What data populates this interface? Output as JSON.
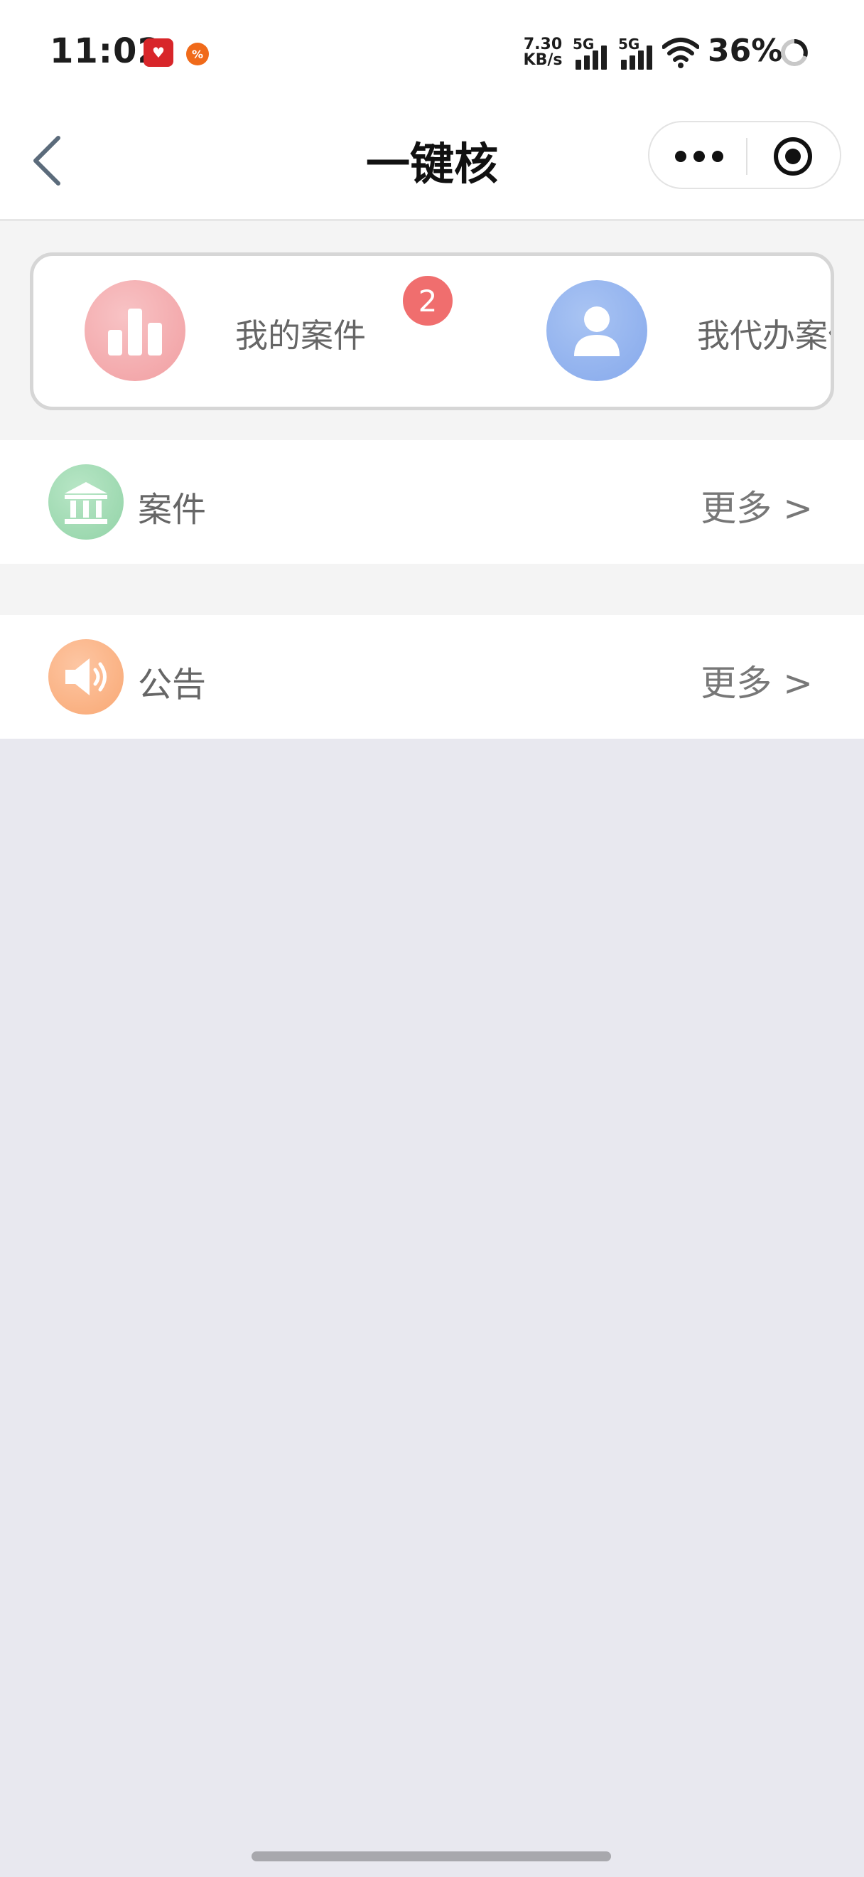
{
  "status_bar": {
    "time": "11:02",
    "net_speed_value": "7.30",
    "net_speed_unit": "KB/s",
    "signal_1_label": "5G",
    "signal_2_label": "5G",
    "battery": "36%"
  },
  "nav": {
    "title": "一键核"
  },
  "quick_entries": [
    {
      "label": "我的案件",
      "badge": "2",
      "icon": "bar-chart-icon",
      "color": "#f4a3a6"
    },
    {
      "label": "我代办案件",
      "badge": "",
      "icon": "person-icon",
      "color": "#8fb2ee"
    }
  ],
  "sections": [
    {
      "title": "案件",
      "more": "更多 >",
      "icon": "bank-icon",
      "color": "#9fd9b2"
    },
    {
      "title": "公告",
      "more": "更多 >",
      "icon": "speaker-icon",
      "color": "#fbb083"
    }
  ]
}
